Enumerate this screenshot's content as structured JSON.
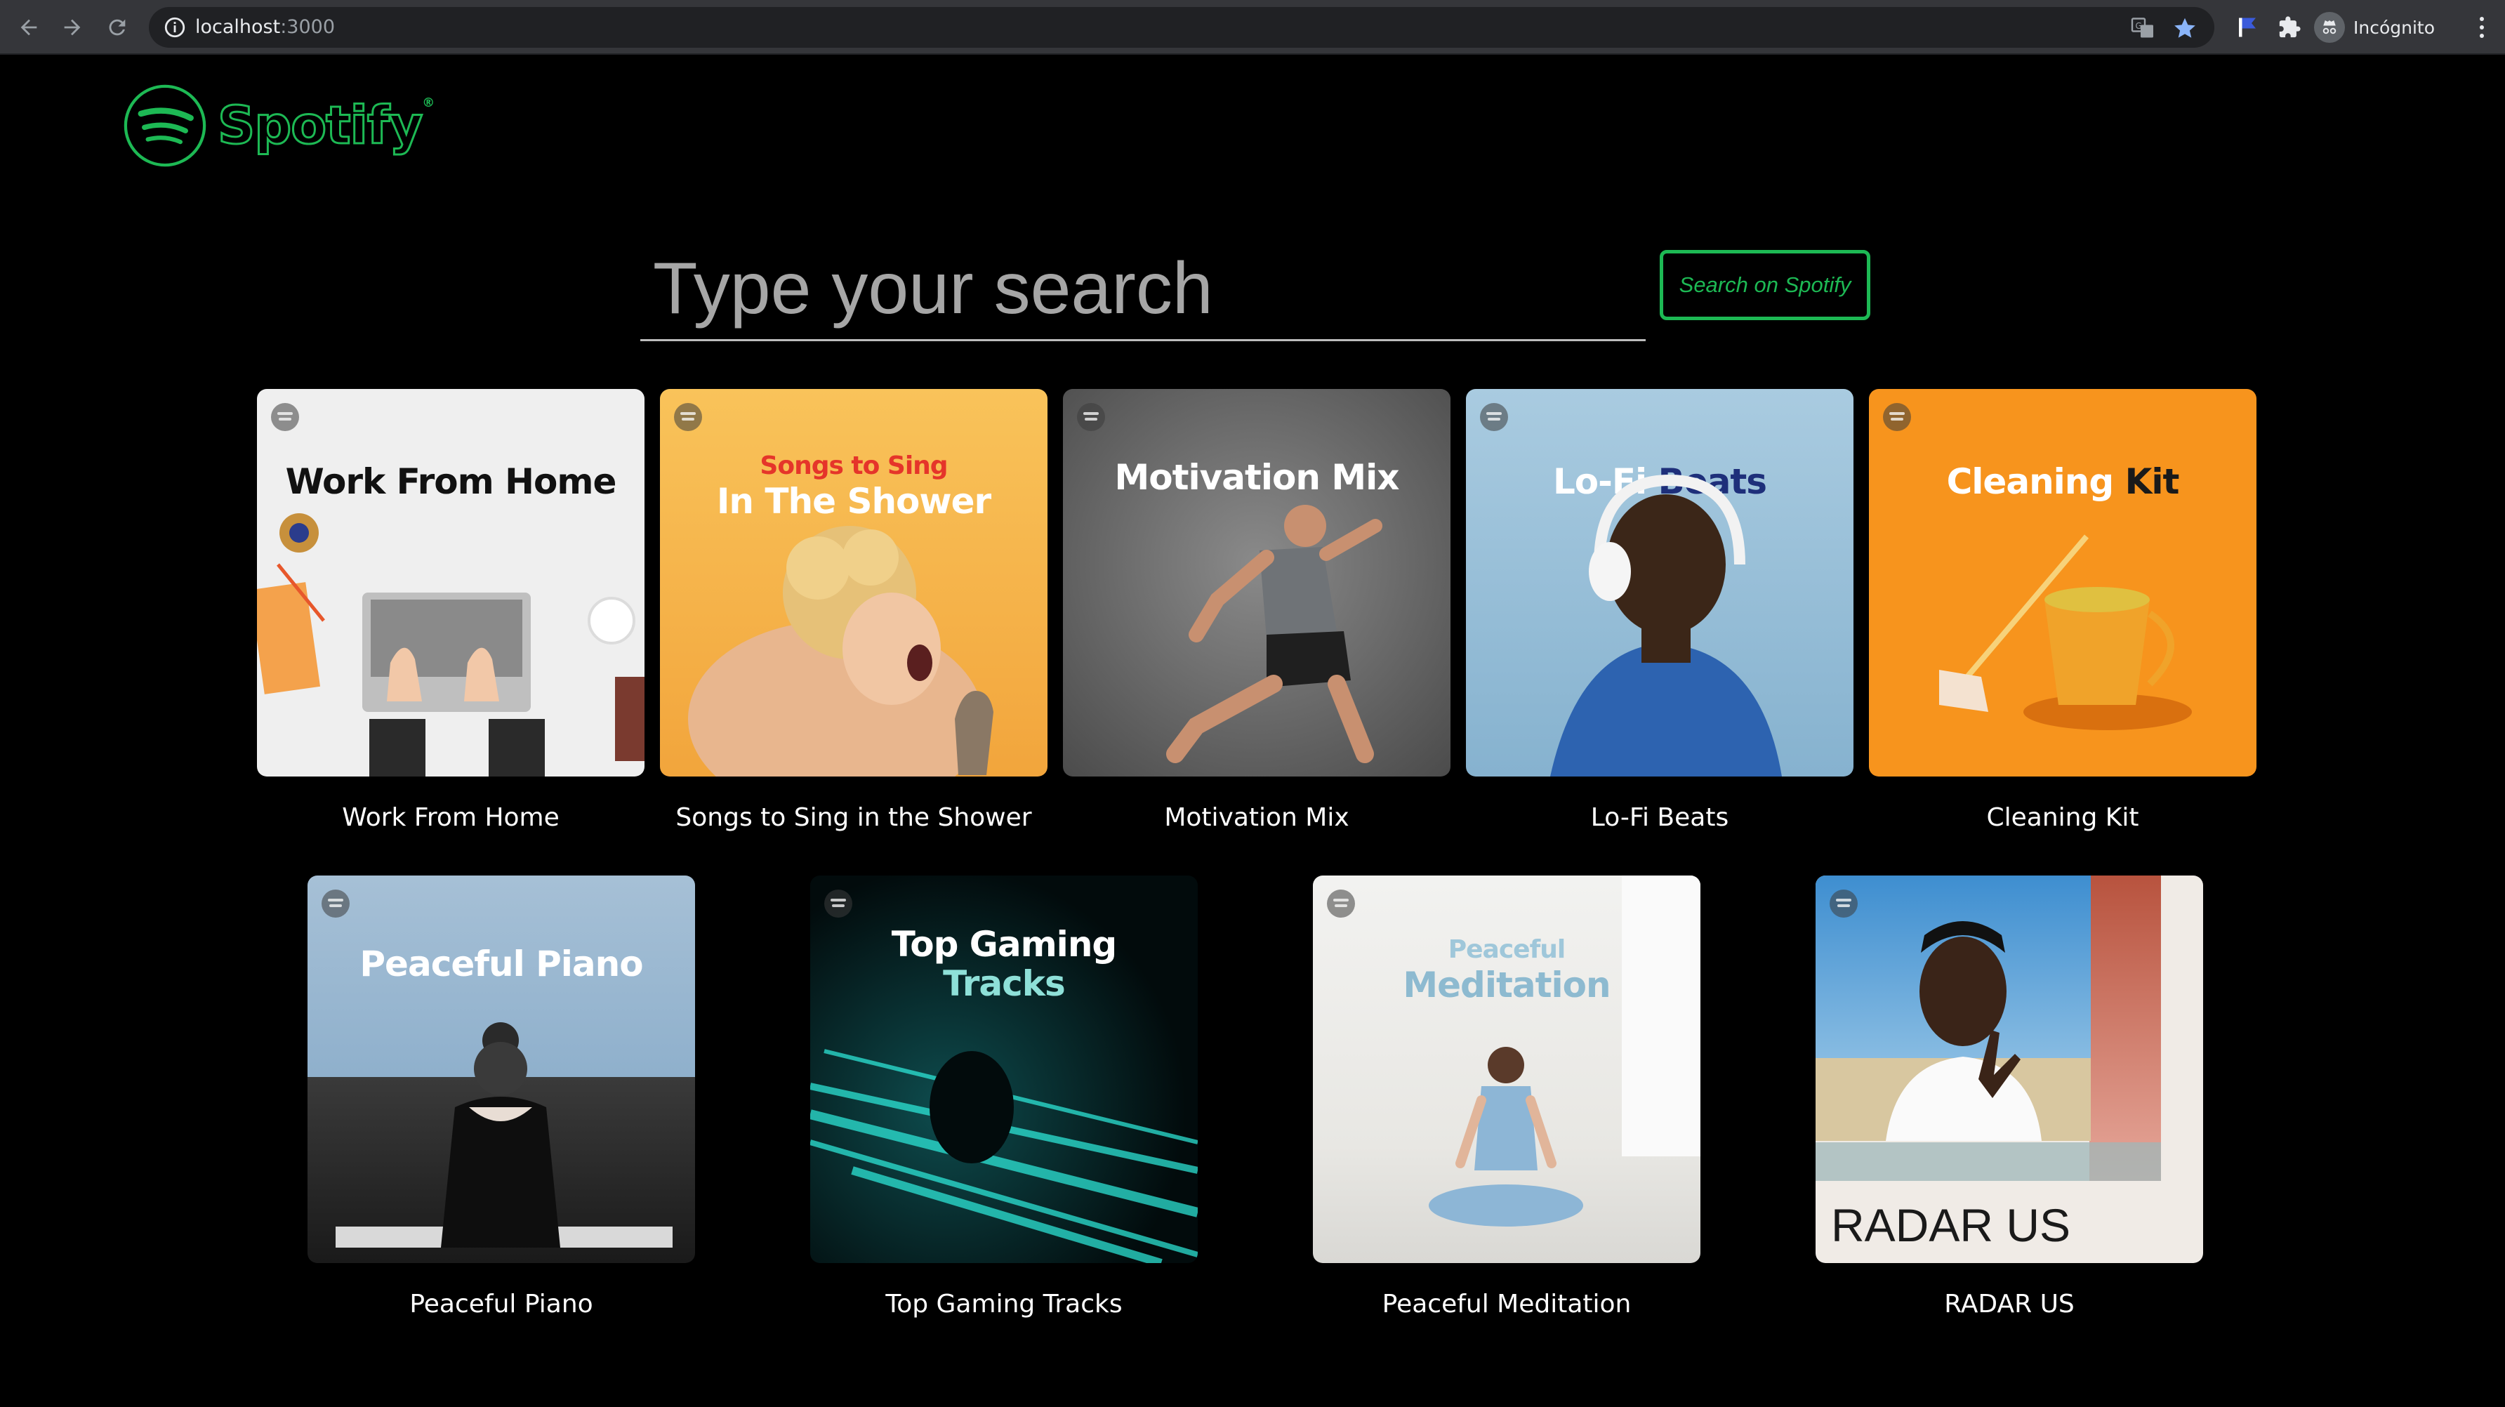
{
  "browser": {
    "url_host": "localhost",
    "url_port": ":3000",
    "profile_label": "Incógnito"
  },
  "brand": {
    "name": "Spotify",
    "trademark": "®",
    "color": "#1db954"
  },
  "search": {
    "placeholder": "Type your search",
    "value": "",
    "button_label": "Search on Spotify"
  },
  "playlists": [
    {
      "label": "Work From Home",
      "cover_title": "Work From Home",
      "cover_bg": "#f0f0f0"
    },
    {
      "label": "Songs to Sing in the Shower",
      "cover_title_top": "Songs to Sing",
      "cover_title": "In The Shower",
      "cover_bg": "#f7b54a"
    },
    {
      "label": "Motivation Mix",
      "cover_title": "Motivation Mix",
      "cover_bg": "#6e6e6e"
    },
    {
      "label": "Lo-Fi Beats",
      "cover_title": "Lo-Fi",
      "cover_title_accent": "Beats",
      "cover_bg": "#9ec5dc"
    },
    {
      "label": "Cleaning Kit",
      "cover_title": "Cleaning",
      "cover_title_accent": "Kit",
      "cover_bg": "#f7931e"
    },
    {
      "label": "Peaceful Piano",
      "cover_title": "Peaceful Piano",
      "cover_bg": "#9cb8d0"
    },
    {
      "label": "Top Gaming Tracks",
      "cover_title": "Top Gaming",
      "cover_title_accent": "Tracks",
      "cover_bg": "#041516"
    },
    {
      "label": "Peaceful Meditation",
      "cover_title_top": "Peaceful",
      "cover_title": "Meditation",
      "cover_bg": "#ececea"
    },
    {
      "label": "RADAR US",
      "cover_title": "RADAR US",
      "cover_bg": "#f0ebe6"
    }
  ]
}
